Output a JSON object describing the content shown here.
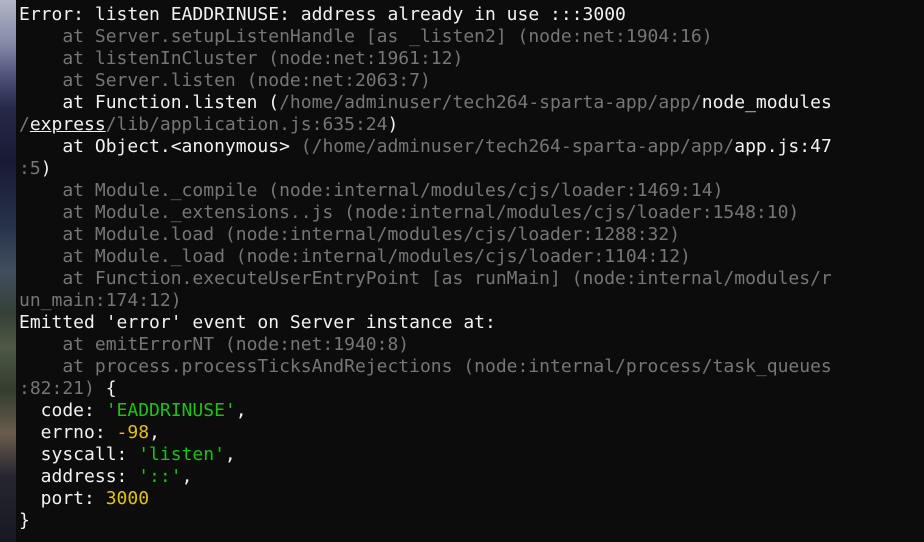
{
  "terminal": {
    "error_line": "Error: listen EADDRINUSE: address already in use :::3000",
    "trace1": "    at Server.setupListenHandle [as _listen2] (node:net:1904:16)",
    "trace2": "    at listenInCluster (node:net:1961:12)",
    "trace3": "    at Server.listen (node:net:2063:7)",
    "trace4_prefix": "    at Function.listen (",
    "trace4_path": "/home/adminuser/tech264-sparta-app/app/",
    "trace4_module_dir": "node_modules",
    "trace4_wrap_slash": "/",
    "trace4_express": "express",
    "trace4_tail": "/lib/application.js:635:24",
    "trace4_close": ")",
    "trace5_prefix": "    at Object.<anonymous> ",
    "trace5_path": "(/home/adminuser/tech264-sparta-app/app/",
    "trace5_file": "app.js:47",
    "trace5_wrap": ":5",
    "trace5_close": ")",
    "trace6": "    at Module._compile (node:internal/modules/cjs/loader:1469:14)",
    "trace7": "    at Module._extensions..js (node:internal/modules/cjs/loader:1548:10)",
    "trace8": "    at Module.load (node:internal/modules/cjs/loader:1288:32)",
    "trace9": "    at Module._load (node:internal/modules/cjs/loader:1104:12)",
    "trace10a": "    at Function.executeUserEntryPoint [as runMain] (node:internal/modules/r",
    "trace10b": "un_main:174:12)",
    "emitted_line": "Emitted 'error' event on Server instance at:",
    "trace11": "    at emitErrorNT (node:net:1940:8)",
    "trace12a": "    at process.processTicksAndRejections (node:internal/process/task_queues",
    "trace12b": ":82:21)",
    "brace_open": " {",
    "obj": {
      "code_key": "  code: ",
      "code_val": "'EADDRINUSE'",
      "errno_key": "  errno: ",
      "errno_val": "-98",
      "syscall_key": "  syscall: ",
      "syscall_val": "'listen'",
      "address_key": "  address: ",
      "address_val": "'::'",
      "port_key": "  port: ",
      "port_val": "3000",
      "comma": ","
    },
    "brace_close": "}"
  },
  "colors": {
    "background": "#0c0c0c",
    "text": "#cccccc",
    "bright": "#f2f2f2",
    "dim": "#767676",
    "string": "#16c60c",
    "number": "#e5c100"
  }
}
